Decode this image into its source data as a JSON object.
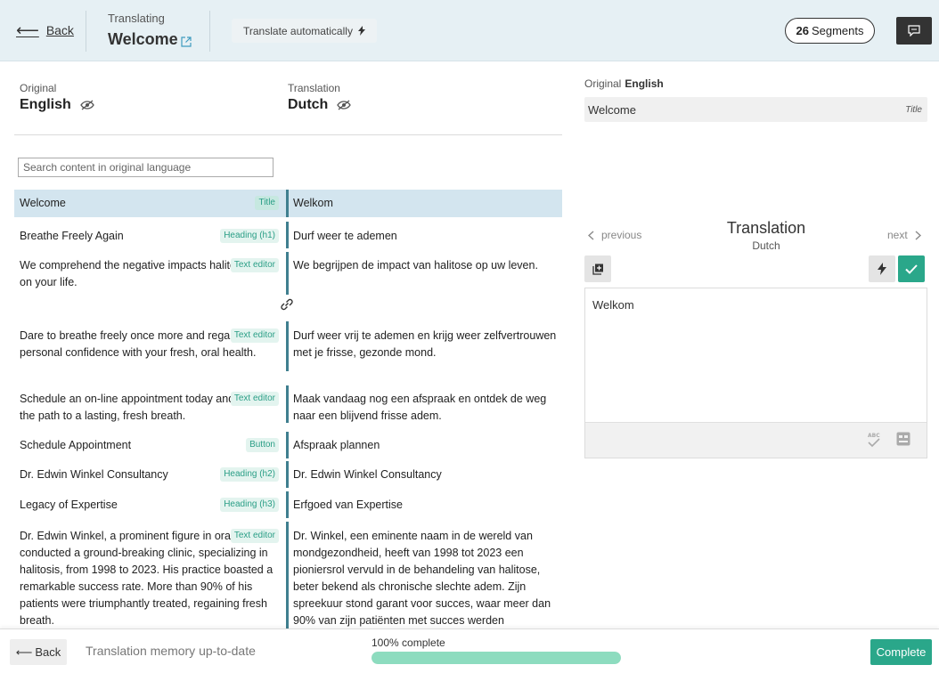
{
  "header": {
    "back_label": "Back",
    "translating_label": "Translating",
    "page_title": "Welcome",
    "auto_translate_label": "Translate automatically",
    "segments_count": "26",
    "segments_label": "Segments",
    "icons": [
      "arrow-left-icon",
      "external-link-icon",
      "bolt-icon",
      "comment-icon"
    ]
  },
  "languages": {
    "original_label": "Original",
    "original_lang": "English",
    "translation_label": "Translation",
    "translation_lang": "Dutch"
  },
  "search": {
    "placeholder": "Search content in original language",
    "value": ""
  },
  "segments": [
    {
      "original": "Welcome",
      "type": "Title",
      "translation": "Welkom",
      "active": true
    },
    {
      "original": "Breathe Freely Again",
      "type": "Heading (h1)",
      "translation": "Durf weer te ademen"
    },
    {
      "original": "We comprehend the negative impacts halitosis have on your life.",
      "type": "Text editor",
      "translation": "We begrijpen de impact van halitose op uw leven."
    },
    {
      "original": "Dare to breathe freely once more and regain personal confidence with your fresh, oral health.",
      "type": "Text editor",
      "translation": "Durf weer vrij te ademen en krijg weer zelfvertrouwen met je frisse, gezonde mond."
    },
    {
      "original": "Schedule an on-line appointment today and explore the path to a lasting, fresh breath.",
      "type": "Text editor",
      "translation": "Maak vandaag nog een afspraak en ontdek de weg naar een blijvend frisse adem."
    },
    {
      "original": "Schedule Appointment",
      "type": "Button",
      "translation": "Afspraak plannen"
    },
    {
      "original": "Dr. Edwin Winkel Consultancy",
      "type": "Heading (h2)",
      "translation": "Dr. Edwin Winkel Consultancy"
    },
    {
      "original": "Legacy of Expertise",
      "type": "Heading (h3)",
      "translation": "Erfgoed van Expertise"
    },
    {
      "original": "Dr. Edwin Winkel, a prominent figure in oral health, conducted a ground-breaking clinic, specializing in halitosis, from 1998 to 2023. His practice boasted a remarkable success rate. More than 90% of his patients were triumphantly treated, regaining fresh breath.",
      "type": "Text editor",
      "translation": "Dr. Winkel, een eminente naam in de wereld van mondgezondheid, heeft van 1998 tot 2023 een pioniersrol vervuld in de behandeling van halitose, beter bekend als chronische slechte adem. Zijn spreekuur stond garant voor succes, waar meer dan 90% van zijn patiënten met succes werden behandeld en een frisse adem herwonnen."
    }
  ],
  "detail": {
    "original_label": "Original",
    "original_lang": "English",
    "original_value": "Welcome",
    "original_type": "Title",
    "prev_label": "previous",
    "next_label": "next",
    "title": "Translation",
    "lang": "Dutch",
    "editor_value": "Welkom",
    "icons": [
      "copy-icon",
      "bolt-icon",
      "check-icon",
      "spellcheck-icon",
      "dictionary-icon"
    ]
  },
  "footer": {
    "back_label": "Back",
    "tm_status": "Translation memory up-to-date",
    "progress_label": "100% complete",
    "progress_percent": 100,
    "complete_label": "Complete"
  },
  "colors": {
    "accent": "#2aa78a",
    "header_bg": "#e6f0f4",
    "active_row": "#d3e5ef",
    "divider": "#3f7f8f",
    "progress": "#8ddcbf"
  }
}
